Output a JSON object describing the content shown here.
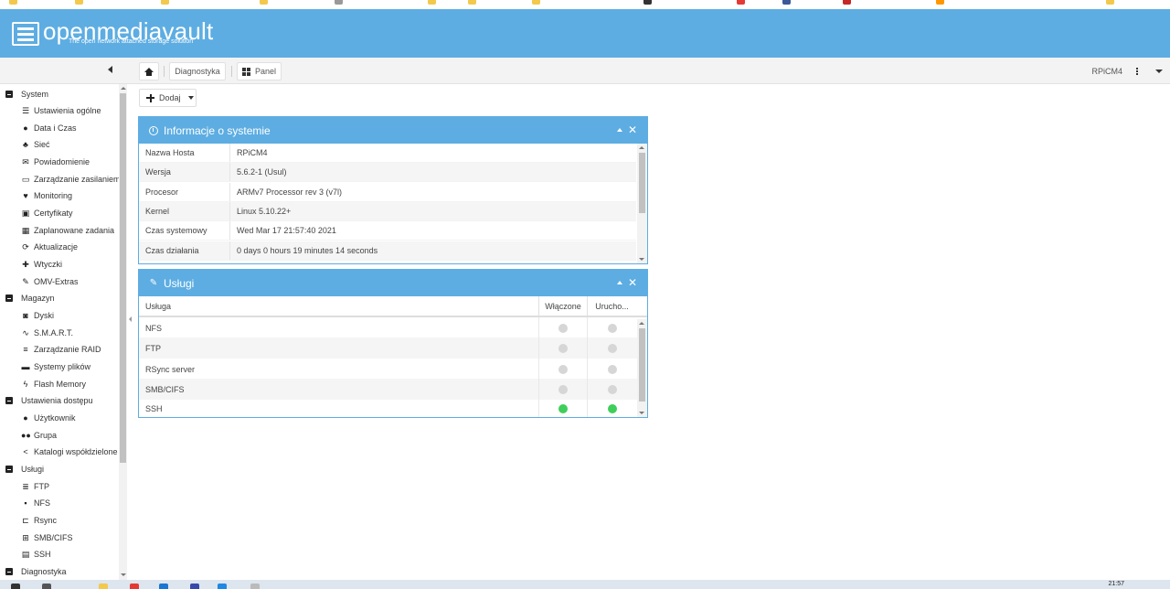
{
  "colors": {
    "header_bg": "#5dade2",
    "panel_bg": "#5dade2",
    "enabled_dot": "#3ecf5a",
    "disabled_dot": "#d6d6d6"
  },
  "app": {
    "title": "openmediavault",
    "subtitle": "The open network attached storage solution"
  },
  "toolbar": {
    "breadcrumb_diag": "Diagnostyka",
    "breadcrumb_panel": "Panel",
    "hostname": "RPiCM4"
  },
  "sidebar": {
    "groups": [
      {
        "label": "System",
        "items": [
          {
            "label": "Ustawienia ogólne",
            "icon": "sliders-icon"
          },
          {
            "label": "Data i Czas",
            "icon": "clock-icon"
          },
          {
            "label": "Sieć",
            "icon": "network-icon"
          },
          {
            "label": "Powiadomienie",
            "icon": "envelope-icon"
          },
          {
            "label": "Zarządzanie zasilaniem",
            "icon": "battery-icon"
          },
          {
            "label": "Monitoring",
            "icon": "heartbeat-icon"
          },
          {
            "label": "Certyfikaty",
            "icon": "certificate-icon"
          },
          {
            "label": "Zaplanowane zadania",
            "icon": "calendar-icon"
          },
          {
            "label": "Aktualizacje",
            "icon": "sync-icon"
          },
          {
            "label": "Wtyczki",
            "icon": "puzzle-icon"
          },
          {
            "label": "OMV-Extras",
            "icon": "wrench-icon"
          }
        ]
      },
      {
        "label": "Magazyn",
        "items": [
          {
            "label": "Dyski",
            "icon": "disk-icon"
          },
          {
            "label": "S.M.A.R.T.",
            "icon": "pulse-icon"
          },
          {
            "label": "Zarządzanie RAID",
            "icon": "raid-icon"
          },
          {
            "label": "Systemy plików",
            "icon": "folders-icon"
          },
          {
            "label": "Flash Memory",
            "icon": "flash-icon"
          }
        ]
      },
      {
        "label": "Ustawienia dostępu",
        "items": [
          {
            "label": "Użytkownik",
            "icon": "user-icon"
          },
          {
            "label": "Grupa",
            "icon": "users-icon"
          },
          {
            "label": "Katalogi współdzielone",
            "icon": "share-icon"
          }
        ]
      },
      {
        "label": "Usługi",
        "items": [
          {
            "label": "FTP",
            "icon": "server-icon"
          },
          {
            "label": "NFS",
            "icon": "desktop-icon"
          },
          {
            "label": "Rsync",
            "icon": "rsync-icon"
          },
          {
            "label": "SMB/CIFS",
            "icon": "windows-icon"
          },
          {
            "label": "SSH",
            "icon": "terminal-icon"
          }
        ]
      },
      {
        "label": "Diagnostyka",
        "items": []
      }
    ]
  },
  "content": {
    "add_button": "Dodaj",
    "sysinfo": {
      "title": "Informacje o systemie",
      "rows": [
        {
          "k": "Nazwa Hosta",
          "v": "RPiCM4"
        },
        {
          "k": "Wersja",
          "v": "5.6.2-1 (Usul)"
        },
        {
          "k": "Procesor",
          "v": "ARMv7 Processor rev 3 (v7l)"
        },
        {
          "k": "Kernel",
          "v": "Linux 5.10.22+"
        },
        {
          "k": "Czas systemowy",
          "v": "Wed Mar 17 21:57:40 2021"
        },
        {
          "k": "Czas działania",
          "v": "0 days 0 hours 19 minutes 14 seconds"
        }
      ]
    },
    "services": {
      "title": "Usługi",
      "columns": [
        "Usługa",
        "Włączone",
        "Urucho..."
      ],
      "rows": [
        {
          "name": "NFS",
          "enabled": false,
          "running": false
        },
        {
          "name": "FTP",
          "enabled": false,
          "running": false
        },
        {
          "name": "RSync server",
          "enabled": false,
          "running": false
        },
        {
          "name": "SMB/CIFS",
          "enabled": false,
          "running": false
        },
        {
          "name": "SSH",
          "enabled": true,
          "running": true
        }
      ]
    }
  },
  "taskbar": {
    "clock": "21:57"
  }
}
